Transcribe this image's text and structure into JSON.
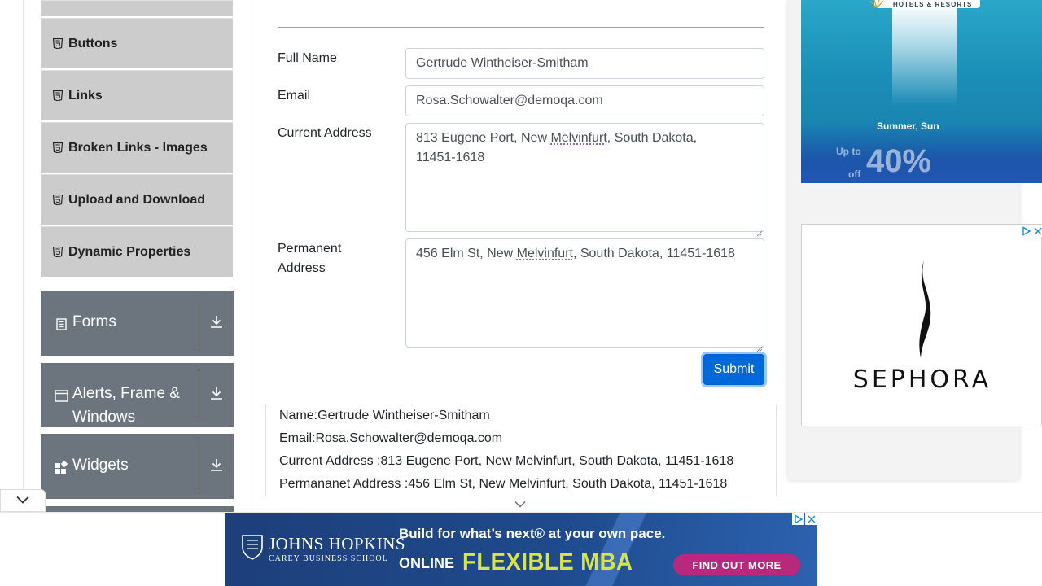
{
  "sidebar": {
    "elements_items": [
      {
        "label": ""
      },
      {
        "label": "Buttons"
      },
      {
        "label": "Links"
      },
      {
        "label": "Broken Links - Images"
      },
      {
        "label": "Upload and Download"
      },
      {
        "label": "Dynamic Properties"
      }
    ],
    "groups": [
      {
        "label": "Forms",
        "icon": "form-icon"
      },
      {
        "label": "Alerts, Frame &",
        "label2": "Windows",
        "icon": "window-icon"
      },
      {
        "label": "Widgets",
        "icon": "widgets-icon"
      }
    ]
  },
  "form": {
    "full_name_label": "Full Name",
    "full_name_value": "Gertrude Wintheiser-Smitham",
    "email_label": "Email",
    "email_value": "Rosa.Schowalter@demoqa.com",
    "current_address_label": "Current Address",
    "current_address_value_pre": "813 Eugene Port, New ",
    "current_address_value_ul": "Melvinfurt",
    "current_address_value_post": ", South Dakota,",
    "current_address_value_line2": "11451-1618",
    "permanent_address_label_1": "Permanent",
    "permanent_address_label_2": "Address",
    "permanent_address_value_pre": "456 Elm St, New ",
    "permanent_address_value_ul": "Melvinfurt",
    "permanent_address_value_post": ", South Dakota, 11451-1618",
    "submit_label": "Submit"
  },
  "output": {
    "name": "Name:Gertrude Wintheiser-Smitham",
    "email": "Email:Rosa.Schowalter@demoqa.com",
    "current_address": "Current Address :813 Eugene Port, New Melvinfurt, South Dakota, 11451-1618",
    "permanent_address": "Permananet Address :456 Elm St, New Melvinfurt, South Dakota, 11451-1618"
  },
  "ads": {
    "hotel": {
      "brand": "HOTELS & RESORTS",
      "tagline": "Summer, Sun",
      "upto": "Up to",
      "off": "off",
      "percent": "40%"
    },
    "sephora": {
      "brand": "SEPHORA"
    },
    "banner": {
      "school_name": "JOHNS HOPKINS",
      "school_sub": "CAREY BUSINESS SCHOOL",
      "headline": "Build for what’s next® at your own pace.",
      "online": "ONLINE",
      "program": "FLEXIBLE MBA",
      "cta": "FIND OUT MORE"
    }
  },
  "colors": {
    "sidebar_item_bg": "#cccccc",
    "group_bg": "#6c757d",
    "submit_bg": "#0069d9",
    "banner_accent": "#d8e54a",
    "cta_bg": "#b8287c"
  }
}
